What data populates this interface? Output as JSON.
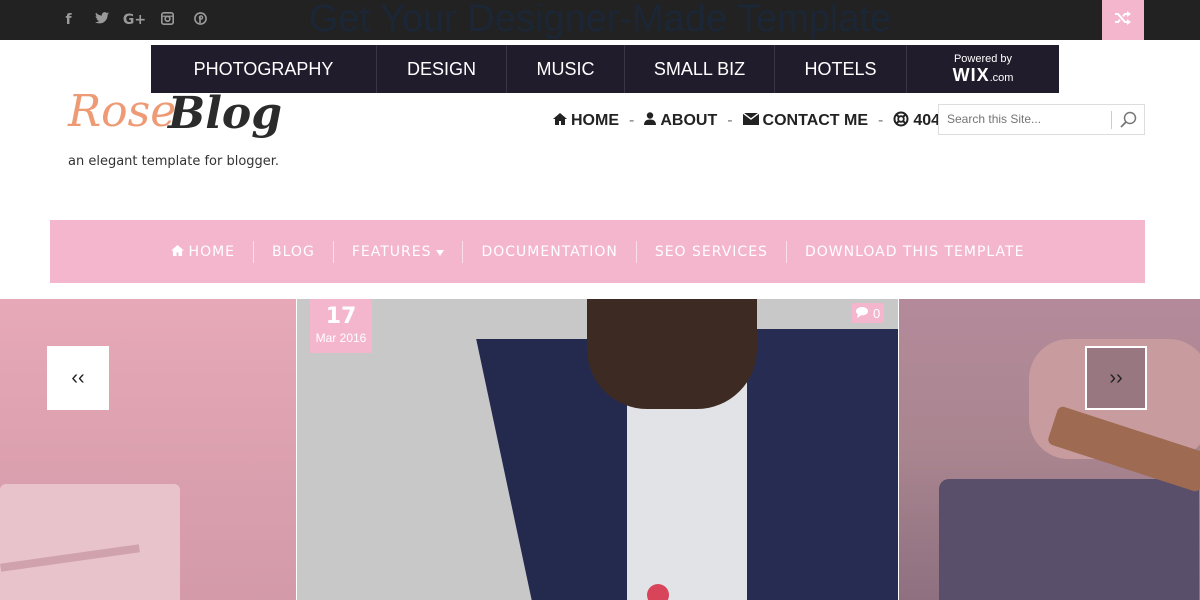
{
  "promo": {
    "text": "Get Your Designer-Made Template"
  },
  "social": [
    {
      "icon": "facebook-icon",
      "glyph": "f"
    },
    {
      "icon": "twitter-icon",
      "glyph": "🐦"
    },
    {
      "icon": "google-plus-icon",
      "glyph": "G+"
    },
    {
      "icon": "instagram-icon",
      "glyph": "◙"
    },
    {
      "icon": "pinterest-icon",
      "glyph": "℗"
    }
  ],
  "wix": {
    "items": [
      "PHOTOGRAPHY",
      "DESIGN",
      "MUSIC",
      "SMALL BIZ",
      "HOTELS"
    ],
    "powered_by": "Powered by",
    "brand": "WIX",
    "brand_suffix": ".com"
  },
  "logo": {
    "rose": "Rose",
    "blog": "Blog",
    "tagline": "an elegant template for blogger."
  },
  "top_menu": {
    "items": [
      {
        "label": "HOME",
        "icon": "home-icon"
      },
      {
        "label": "ABOUT",
        "icon": "user-icon"
      },
      {
        "label": "CONTACT ME",
        "icon": "envelope-icon"
      },
      {
        "label": "404",
        "icon": "life-ring-icon"
      }
    ],
    "separator": "-"
  },
  "search": {
    "placeholder": "Search this Site..."
  },
  "main_nav": {
    "items": [
      "HOME",
      "BLOG",
      "FEATURES",
      "DOCUMENTATION",
      "SEO SERVICES",
      "DOWNLOAD THIS TEMPLATE"
    ]
  },
  "slider": {
    "date_day": "17",
    "date_month": "Mar 2016",
    "comment_count": "0",
    "prev_label": "‹‹",
    "next_label": "››"
  },
  "colors": {
    "pink": "#f4b6cd",
    "dark": "#222222",
    "wixbar": "#201c2c"
  }
}
